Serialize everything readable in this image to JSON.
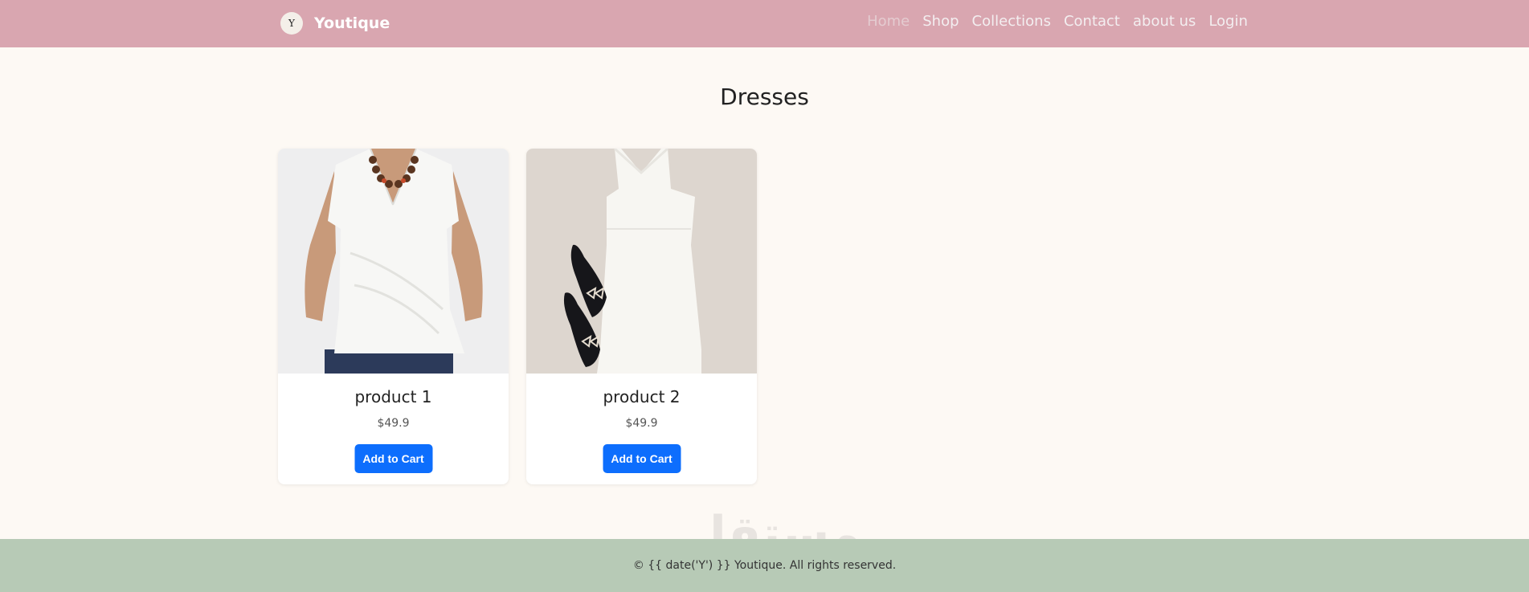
{
  "nav": {
    "brand": "Youtique",
    "logo_text": "Y",
    "links": [
      "Home",
      "Shop",
      "Collections",
      "Contact",
      "about us",
      "Login"
    ]
  },
  "page_title": "Dresses",
  "products": [
    {
      "name": "product 1",
      "price": "$49.9",
      "button": "Add to Cart",
      "image": "white-wrap-top-photo"
    },
    {
      "name": "product 2",
      "price": "$49.9",
      "button": "Add to Cart",
      "image": "white-dress-heels-photo"
    }
  ],
  "watermark": "مستقل",
  "footer": {
    "text": "© {{ date('Y') }} Youtique. All rights reserved."
  },
  "colors": {
    "navbar": "#d9a6b0",
    "footer": "#b7cab6",
    "page_bg": "#fdf9f4",
    "button": "#0d6efd"
  }
}
